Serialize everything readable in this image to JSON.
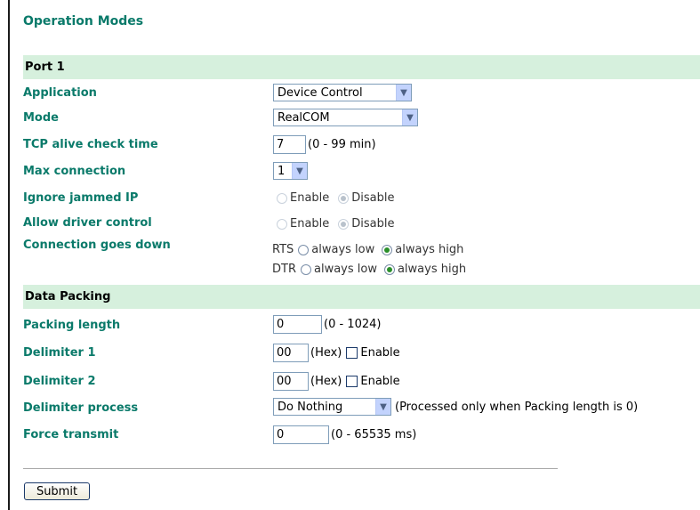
{
  "title": "Operation Modes",
  "port_section": {
    "heading": "Port 1",
    "application": {
      "label": "Application",
      "value": "Device Control"
    },
    "mode": {
      "label": "Mode",
      "value": "RealCOM"
    },
    "tcp_alive": {
      "label": "TCP alive check time",
      "value": "7",
      "unit": "(0 - 99 min)"
    },
    "max_connection": {
      "label": "Max connection",
      "value": "1"
    },
    "ignore_jammed_ip": {
      "label": "Ignore jammed IP",
      "opt1": "Enable",
      "opt2": "Disable",
      "selected": "Disable"
    },
    "allow_driver_control": {
      "label": "Allow driver control",
      "opt1": "Enable",
      "opt2": "Disable",
      "selected": "Disable"
    },
    "connection_goes_down": {
      "label": "Connection goes down",
      "rts": {
        "name": "RTS",
        "opt1": "always low",
        "opt2": "always high",
        "selected": "always high"
      },
      "dtr": {
        "name": "DTR",
        "opt1": "always low",
        "opt2": "always high",
        "selected": "always high"
      }
    }
  },
  "data_packing": {
    "heading": "Data Packing",
    "packing_length": {
      "label": "Packing length",
      "value": "0",
      "unit": "(0 - 1024)"
    },
    "delimiter1": {
      "label": "Delimiter 1",
      "value": "00",
      "unit": "(Hex)",
      "check_label": "Enable",
      "checked": false
    },
    "delimiter2": {
      "label": "Delimiter 2",
      "value": "00",
      "unit": "(Hex)",
      "check_label": "Enable",
      "checked": false
    },
    "delimiter_process": {
      "label": "Delimiter process",
      "value": "Do Nothing",
      "note": "(Processed only when Packing length is 0)"
    },
    "force_transmit": {
      "label": "Force transmit",
      "value": "0",
      "unit": "(0 - 65535 ms)"
    }
  },
  "submit_label": "Submit",
  "colors": {
    "label_green": "#0a7a6a",
    "section_bg": "#d6f0dd"
  }
}
